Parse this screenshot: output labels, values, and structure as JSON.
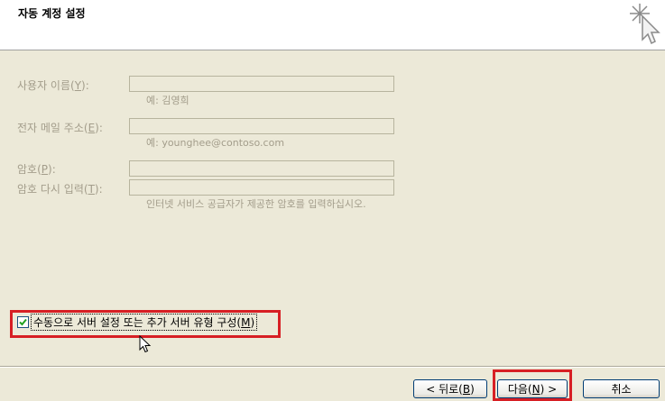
{
  "header": {
    "title": "자동 계정 설정"
  },
  "form": {
    "name_label_pre": "사용자 이름(",
    "name_label_key": "Y",
    "name_label_post": "):",
    "name_value": "",
    "name_hint": "예: 김영희",
    "email_label_pre": "전자 메일 주소(",
    "email_label_key": "E",
    "email_label_post": "):",
    "email_value": "",
    "email_hint": "예: younghee@contoso.com",
    "password_label_pre": "암호(",
    "password_label_key": "P",
    "password_label_post": "):",
    "password_value": "",
    "retype_label_pre": "암호 다시 입력(",
    "retype_label_key": "T",
    "retype_label_post": "):",
    "retype_value": "",
    "password_hint": "인터넷 서비스 공급자가 제공한 암호를 입력하십시오."
  },
  "manual_config": {
    "checked": true,
    "label_pre": "수동으로 서버 설정 또는 추가 서버 유형 구성(",
    "label_key": "M",
    "label_post": ")"
  },
  "buttons": {
    "back_pre": "< 뒤로(",
    "back_key": "B",
    "back_post": ")",
    "next_pre": "다음(",
    "next_key": "N",
    "next_post": ") >",
    "cancel": "취소"
  },
  "colors": {
    "highlight": "#d71f24",
    "background": "#ece9d8",
    "disabled_text": "#a39d8b"
  }
}
